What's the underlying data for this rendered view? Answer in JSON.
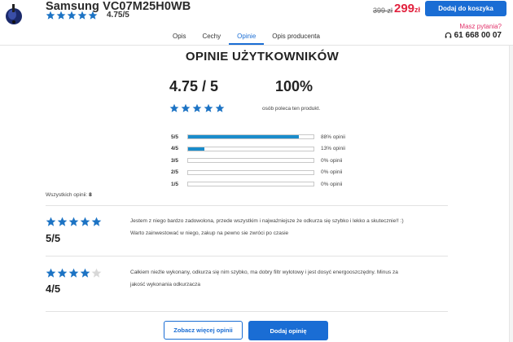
{
  "product": {
    "title": "Samsung VC07M25H0WB",
    "rating": 4.75,
    "rating_text": "4.75/5",
    "old_price": "399 zł",
    "new_price": "299",
    "currency": "zł",
    "add_to_cart_label": "Dodaj do koszyka"
  },
  "tabs": [
    {
      "label": "Opis"
    },
    {
      "label": "Cechy"
    },
    {
      "label": "Opinie",
      "active": true
    },
    {
      "label": "Opis producenta"
    }
  ],
  "contact": {
    "ask_label": "Masz pytania?",
    "phone": "61 668 00 07"
  },
  "reviews_summary": {
    "title": "OPINIE UŻYTKOWNIKÓW",
    "average": "4.75 / 5",
    "average_value": 4.75,
    "recommend_percent": "100%",
    "recommend_text": "osób poleca ten produkt.",
    "breakdown": [
      {
        "label": "5/5",
        "percent": 88,
        "text": "88% opinii"
      },
      {
        "label": "4/5",
        "percent": 13,
        "text": "13% opinii"
      },
      {
        "label": "3/5",
        "percent": 0,
        "text": "0% opinii"
      },
      {
        "label": "2/5",
        "percent": 0,
        "text": "0% opinii"
      },
      {
        "label": "1/5",
        "percent": 0,
        "text": "0% opinii"
      }
    ],
    "total_label": "Wszystkich opinii:",
    "total_count": "8"
  },
  "reviews": [
    {
      "stars": 5,
      "score": "5/5",
      "text_line1": "Jestem z niego bardzo zadowolona, przede wszystkim i najważniejsze że odkurza się szybko i lekko a skutecznie!! :)",
      "text_line2": "Warto zainwestować w niego, zakup na pewno sie zwróci po czasie"
    },
    {
      "stars": 4,
      "score": "4/5",
      "text_line1": "Całkiem nieźle wykonany, odkurza się nim szybko, ma dobry filtr wylotowy i jest dosyć energooszczędny. Minus za",
      "text_line2": "jakość wykonania odkurzacza"
    }
  ],
  "actions": {
    "more_label": "Zobacz więcej opinii",
    "add_label": "Dodaj opinię"
  },
  "colors": {
    "accent": "#1a6dd4",
    "star": "#1c73c4",
    "star_empty": "#d8d8d8",
    "price": "#e2233f",
    "bar": "#1a8ccb"
  },
  "icons": {
    "phone": "headset-icon",
    "star": "star-icon",
    "thumb": "product-thumbnail"
  }
}
